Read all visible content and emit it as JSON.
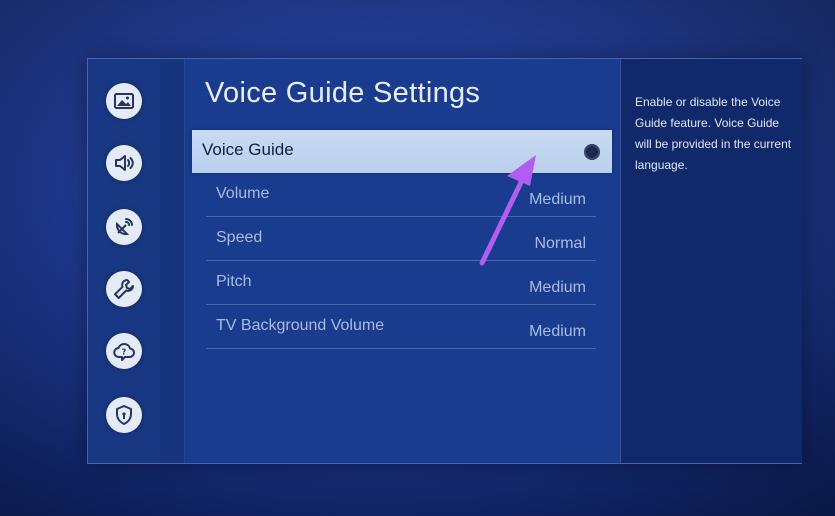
{
  "title": "Voice Guide Settings",
  "sidebar": {
    "items": [
      {
        "icon": "picture-icon"
      },
      {
        "icon": "sound-icon"
      },
      {
        "icon": "broadcasting-icon"
      },
      {
        "icon": "wrench-icon"
      },
      {
        "icon": "support-icon"
      },
      {
        "icon": "privacy-shield-icon"
      }
    ]
  },
  "settings": {
    "voice_guide": {
      "label": "Voice Guide",
      "state": "off"
    },
    "volume": {
      "label": "Volume",
      "value": "Medium"
    },
    "speed": {
      "label": "Speed",
      "value": "Normal"
    },
    "pitch": {
      "label": "Pitch",
      "value": "Medium"
    },
    "tv_background_volume": {
      "label": "TV Background Volume",
      "value": "Medium"
    }
  },
  "info": {
    "text": "Enable or disable the Voice Guide feature. Voice Guide will be provided in the current language."
  },
  "colors": {
    "background": "#1a3590",
    "selected_row": "#c9dbf3",
    "annotation_arrow": "#b25cf2"
  }
}
